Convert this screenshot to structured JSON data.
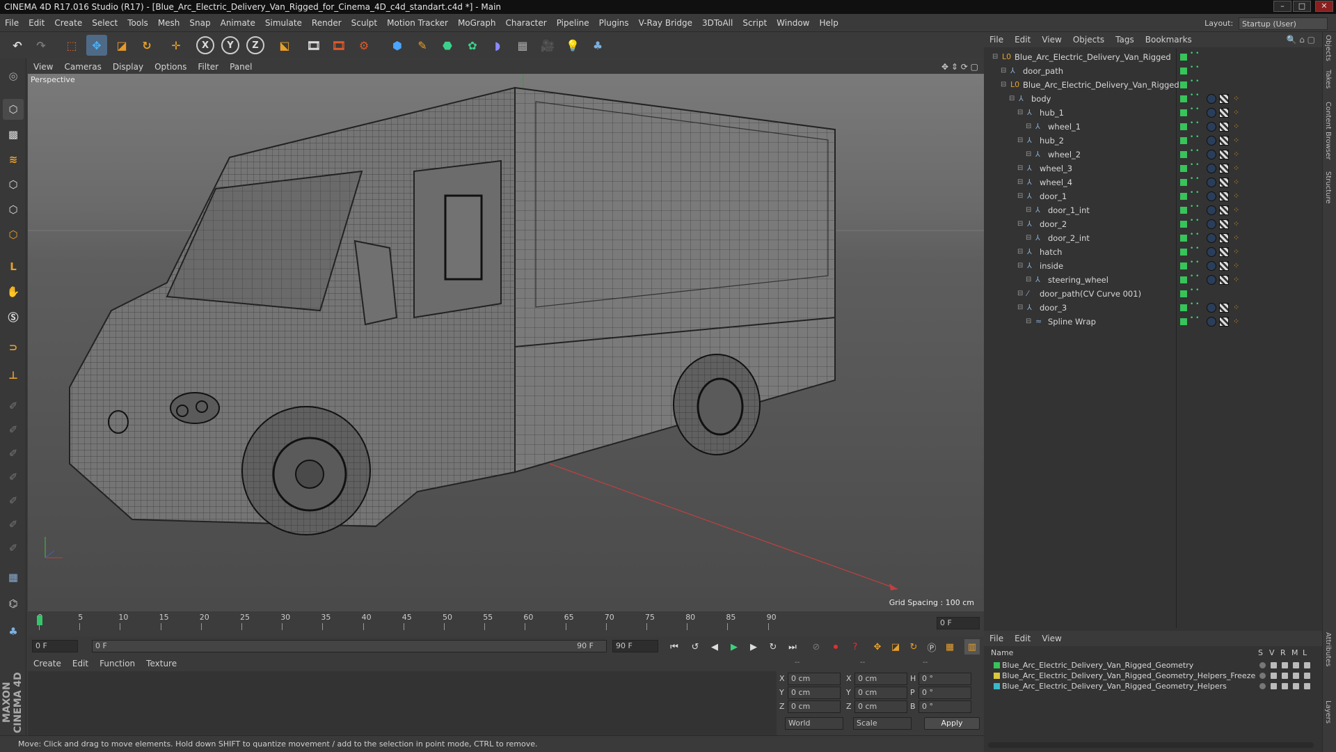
{
  "window": {
    "title": "CINEMA 4D R17.016 Studio (R17) - [Blue_Arc_Electric_Delivery_Van_Rigged_for_Cinema_4D_c4d_standart.c4d *] - Main"
  },
  "menubar": {
    "items": [
      "File",
      "Edit",
      "Create",
      "Select",
      "Tools",
      "Mesh",
      "Snap",
      "Animate",
      "Simulate",
      "Render",
      "Sculpt",
      "Motion Tracker",
      "MoGraph",
      "Character",
      "Pipeline",
      "Plugins",
      "V-Ray Bridge",
      "3DToAll",
      "Script",
      "Window",
      "Help"
    ],
    "layout_label": "Layout:",
    "layout_value": "Startup (User)"
  },
  "toolbar": {
    "axis_x": "X",
    "axis_y": "Y",
    "axis_z": "Z"
  },
  "viewport": {
    "menu": [
      "View",
      "Cameras",
      "Display",
      "Options",
      "Filter",
      "Panel"
    ],
    "camera_label": "Perspective",
    "grid_spacing": "Grid Spacing : 100 cm"
  },
  "timeline": {
    "ticks": [
      "0",
      "5",
      "10",
      "15",
      "20",
      "25",
      "30",
      "35",
      "40",
      "45",
      "50",
      "55",
      "60",
      "65",
      "70",
      "75",
      "80",
      "85",
      "90"
    ],
    "current_frame_field": "0 F",
    "start_field": "0 F",
    "range_start": "0 F",
    "range_end": "90 F",
    "end_field": "90 F"
  },
  "material_manager": {
    "menu": [
      "Create",
      "Edit",
      "Function",
      "Texture"
    ]
  },
  "coordinates": {
    "headers": [
      "--",
      "--",
      "--"
    ],
    "rows": [
      {
        "a": "X",
        "av": "0 cm",
        "b": "X",
        "bv": "0 cm",
        "c": "H",
        "cv": "0 °"
      },
      {
        "a": "Y",
        "av": "0 cm",
        "b": "Y",
        "bv": "0 cm",
        "c": "P",
        "cv": "0 °"
      },
      {
        "a": "Z",
        "av": "0 cm",
        "b": "Z",
        "bv": "0 cm",
        "c": "B",
        "cv": "0 °"
      }
    ],
    "world": "World",
    "scale": "Scale",
    "apply": "Apply"
  },
  "status": {
    "text": "Move: Click and drag to move elements. Hold down SHIFT to quantize movement / add to the selection in point mode, CTRL to remove."
  },
  "object_manager": {
    "menu": [
      "File",
      "Edit",
      "View",
      "Objects",
      "Tags",
      "Bookmarks"
    ],
    "objects": [
      {
        "name": "Blue_Arc_Electric_Delivery_Van_Rigged",
        "level": 0,
        "icon": "null-icon"
      },
      {
        "name": "door_path",
        "level": 1,
        "icon": "joint-icon"
      },
      {
        "name": "Blue_Arc_Electric_Delivery_Van_Rigged",
        "level": 1,
        "icon": "null-icon"
      },
      {
        "name": "body",
        "level": 2,
        "icon": "joint-icon"
      },
      {
        "name": "hub_1",
        "level": 3,
        "icon": "joint-icon"
      },
      {
        "name": "wheel_1",
        "level": 4,
        "icon": "joint-icon"
      },
      {
        "name": "hub_2",
        "level": 3,
        "icon": "joint-icon"
      },
      {
        "name": "wheel_2",
        "level": 4,
        "icon": "joint-icon"
      },
      {
        "name": "wheel_3",
        "level": 3,
        "icon": "joint-icon"
      },
      {
        "name": "wheel_4",
        "level": 3,
        "icon": "joint-icon"
      },
      {
        "name": "door_1",
        "level": 3,
        "icon": "joint-icon"
      },
      {
        "name": "door_1_int",
        "level": 4,
        "icon": "joint-icon"
      },
      {
        "name": "door_2",
        "level": 3,
        "icon": "joint-icon"
      },
      {
        "name": "door_2_int",
        "level": 4,
        "icon": "joint-icon"
      },
      {
        "name": "hatch",
        "level": 3,
        "icon": "joint-icon"
      },
      {
        "name": "inside",
        "level": 3,
        "icon": "joint-icon"
      },
      {
        "name": "steering_wheel",
        "level": 4,
        "icon": "joint-icon"
      },
      {
        "name": "door_path(CV Curve 001)",
        "level": 3,
        "icon": "spline-icon"
      },
      {
        "name": "door_3",
        "level": 3,
        "icon": "joint-icon"
      },
      {
        "name": "Spline Wrap",
        "level": 4,
        "icon": "spline-wrap-icon"
      }
    ]
  },
  "layer_manager": {
    "menu": [
      "File",
      "Edit",
      "View"
    ],
    "headers": {
      "name": "Name",
      "s": "S",
      "v": "V",
      "r": "R",
      "m": "M",
      "l": "L"
    },
    "layers": [
      {
        "name": "Blue_Arc_Electric_Delivery_Van_Rigged_Geometry",
        "color": "#37c45a"
      },
      {
        "name": "Blue_Arc_Electric_Delivery_Van_Rigged_Geometry_Helpers_Freeze",
        "color": "#d8c83a"
      },
      {
        "name": "Blue_Arc_Electric_Delivery_Van_Rigged_Geometry_Helpers",
        "color": "#3ab8c8"
      }
    ]
  },
  "right_tabs": [
    "Objects",
    "Takes",
    "Content Browser",
    "Structure",
    "Attributes",
    "Layers"
  ],
  "brand": "MAXON CINEMA 4D"
}
